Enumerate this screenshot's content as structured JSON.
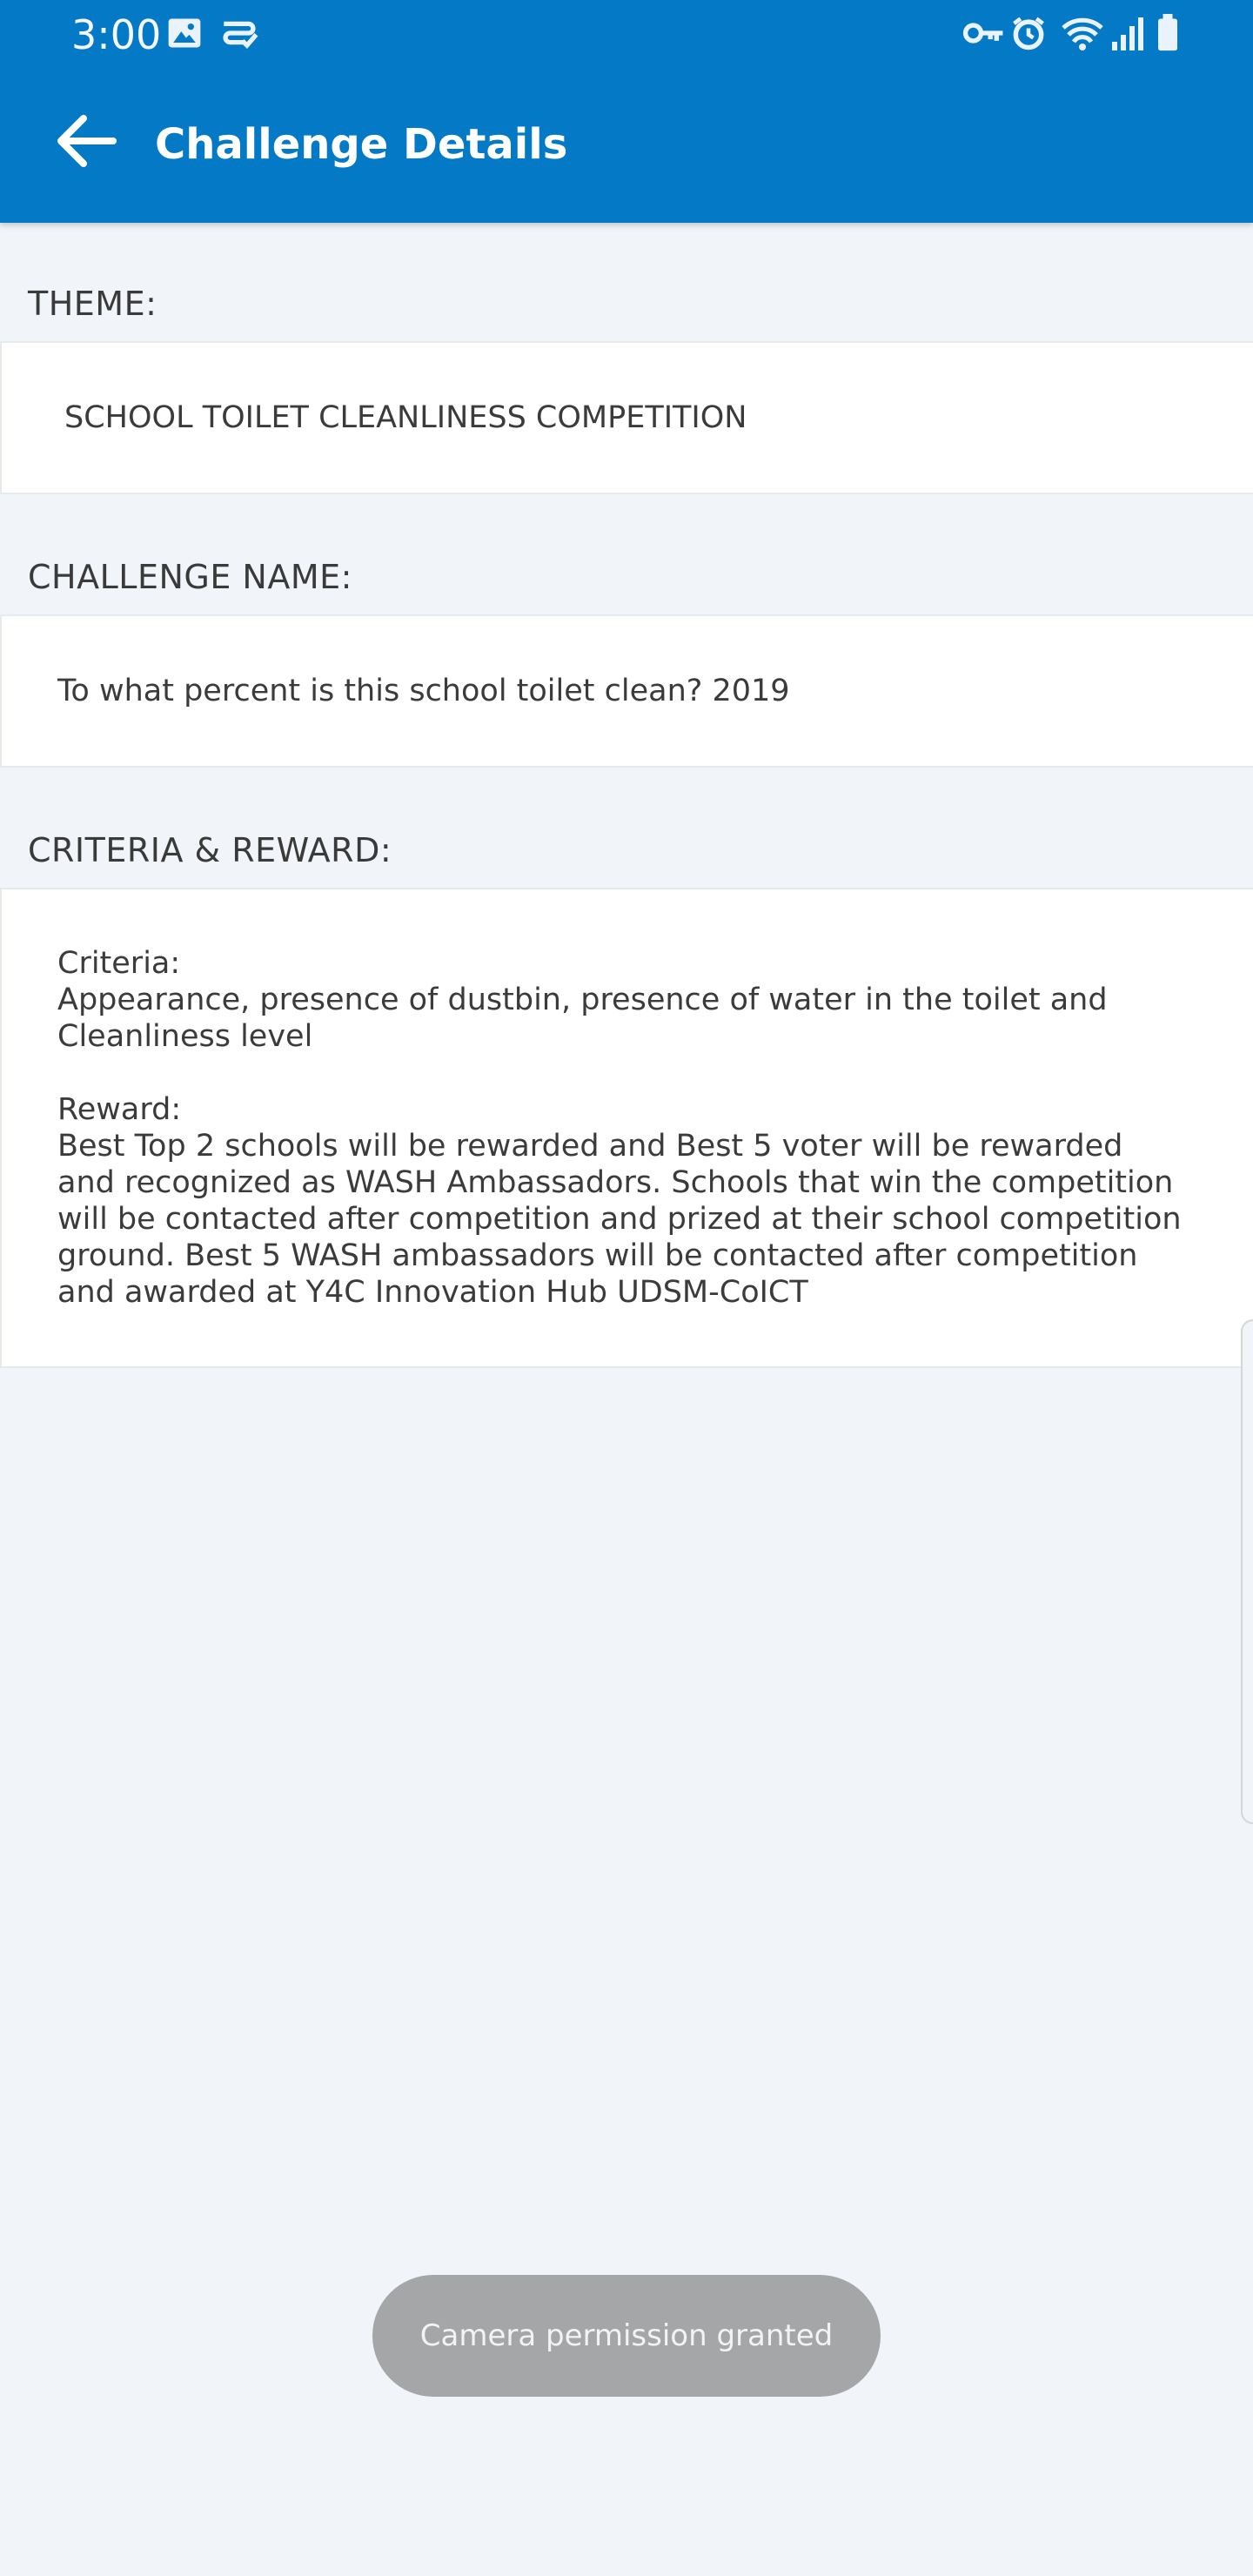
{
  "status_bar": {
    "time": "3:00",
    "left_icons": [
      "image-icon",
      "notification-app-icon"
    ],
    "right_icons": [
      "vpn-key-icon",
      "alarm-icon",
      "wifi-icon",
      "signal-icon",
      "battery-icon"
    ]
  },
  "toolbar": {
    "title": "Challenge Details",
    "back_icon": "arrow-back-icon"
  },
  "sections": {
    "theme": {
      "label": "THEME:",
      "value": "SCHOOL TOILET CLEANLINESS COMPETITION"
    },
    "challenge_name": {
      "label": "CHALLENGE NAME:",
      "value": "To what percent is this school toilet clean? 2019"
    },
    "criteria_reward": {
      "label": "CRITERIA & REWARD:",
      "criteria_heading": "Criteria:",
      "criteria_text": "Appearance, presence of dustbin, presence of water in the toilet and Cleanliness level",
      "reward_heading": "Reward:",
      "reward_text": "Best Top 2 schools will be rewarded and Best 5 voter will be rewarded and recognized as WASH Ambassadors. Schools that win the competition will be contacted after competition and prized at their school competition ground.  Best 5 WASH ambassadors will be contacted after competition and awarded at Y4C Innovation Hub UDSM-CoICT"
    }
  },
  "toast": {
    "message": "Camera permission granted"
  },
  "colors": {
    "primary": "#0479c6",
    "background": "#f1f4f9",
    "card": "#ffffff",
    "toast": "#a5a6a8"
  }
}
